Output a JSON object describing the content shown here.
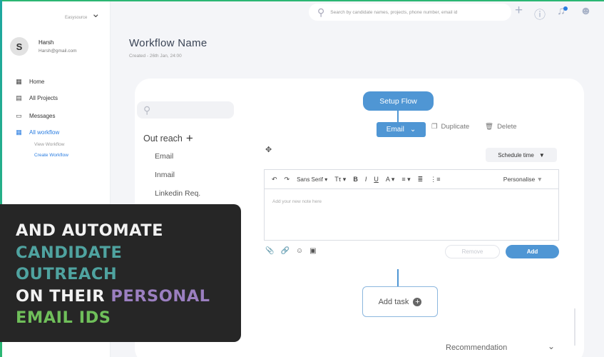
{
  "sidebar": {
    "brand": "Easysource",
    "user": {
      "initial": "S",
      "name": "Harsh",
      "email": "Harsh@gmail.com"
    },
    "items": [
      {
        "label": "Home",
        "icon": "grid-icon"
      },
      {
        "label": "All Projects",
        "icon": "list-icon"
      },
      {
        "label": "Messages",
        "icon": "monitor-icon"
      },
      {
        "label": "All workflow",
        "icon": "grid-icon",
        "active": true
      }
    ],
    "sub_items": [
      {
        "label": "View Workflow"
      },
      {
        "label": "Create Workflow",
        "active": true
      }
    ]
  },
  "topbar": {
    "search_placeholder": "Search by candidate names, projects, phone number,  email id"
  },
  "header": {
    "title": "Workflow  Name",
    "created": "Created - 26th Jan, 24:00"
  },
  "left_panel": {
    "section": "Out reach",
    "items": [
      "Email",
      "Inmail",
      "Linkedin Req."
    ]
  },
  "flow": {
    "setup": "Setup Flow",
    "email": "Email",
    "duplicate": "Duplicate",
    "delete": "Delete",
    "schedule": "Schedule time",
    "toolbar": {
      "font": "Sans Serif",
      "personalise": "Personalise"
    },
    "note_placeholder": "Add your new  note here",
    "remove": "Remove",
    "add": "Add",
    "add_task": "Add task",
    "recommendation": "Recommendation"
  },
  "caption": {
    "line1": "AND AUTOMATE",
    "line2": "CANDIDATE",
    "line3": "OUTREACH",
    "line4a": "ON THEIR ",
    "line4b": "PERSONAL",
    "line5": "EMAIL IDS"
  },
  "colors": {
    "accent": "#4f96d4",
    "active_nav": "#2a7de1",
    "caption_bg": "#262626",
    "caption_teal": "#4fa3a0",
    "caption_purple": "#9b7fc0",
    "caption_green": "#6fbf5a"
  }
}
